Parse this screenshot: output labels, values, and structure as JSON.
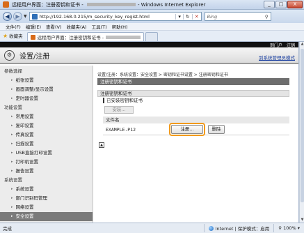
{
  "window": {
    "title": "远程用户界面：注册密钥和证书 - ",
    "title_app": "- Windows Internet Explorer",
    "controls": [
      "_",
      "□",
      "X"
    ]
  },
  "address": {
    "url": "http://192.168.0.215/m_security_key_regist.html",
    "search_placeholder": "Bing"
  },
  "menu": [
    "文件(F)",
    "编辑(E)",
    "查看(V)",
    "收藏夹(A)",
    "工具(T)",
    "帮助(H)"
  ],
  "favorites": {
    "label": "收藏夹",
    "tab_label": "远程用户界面：注册密钥和证书 -"
  },
  "header": {
    "strip_links": [
      "到门户",
      "注销"
    ],
    "page_title": "设置/注册",
    "admin_link": "到系统管理员模式"
  },
  "sidebar": {
    "sections": [
      {
        "title": "参数选择",
        "items": [
          "纸张设置",
          "画面调整/显示设置",
          "定时器设置"
        ]
      },
      {
        "title": "功能设置",
        "items": [
          "常用设置",
          "复印设置",
          "传真设置",
          "扫描设置",
          "USB直接打印设置",
          "打印机设置",
          "报告设置"
        ]
      },
      {
        "title": "系统设置",
        "items": [
          "系统设置",
          "部门识别码管理",
          "网络设置",
          "安全设置"
        ]
      }
    ],
    "active_item": "安全设置"
  },
  "content": {
    "breadcrumb": "设置/注册：系统设置：安全设置 > 密钥和证书设置 > 注册密钥和证书",
    "section_title": "注册密钥和证书",
    "subsection_title": "注册密钥和证书",
    "installed_title": "已安装密钥和证书",
    "install_button": "安装...",
    "table_header": "文件名",
    "file_name": "EXAMPLE.P12",
    "register_button": "注册...",
    "delete_button": "删除"
  },
  "status": {
    "left": "完成",
    "zone": "Internet | 保护模式：启用",
    "zoom": "100%"
  },
  "colors": {
    "highlight_ring": "#f29a1a",
    "section_bar": "#6e6e6e",
    "active_nav": "#7a7a7a"
  }
}
